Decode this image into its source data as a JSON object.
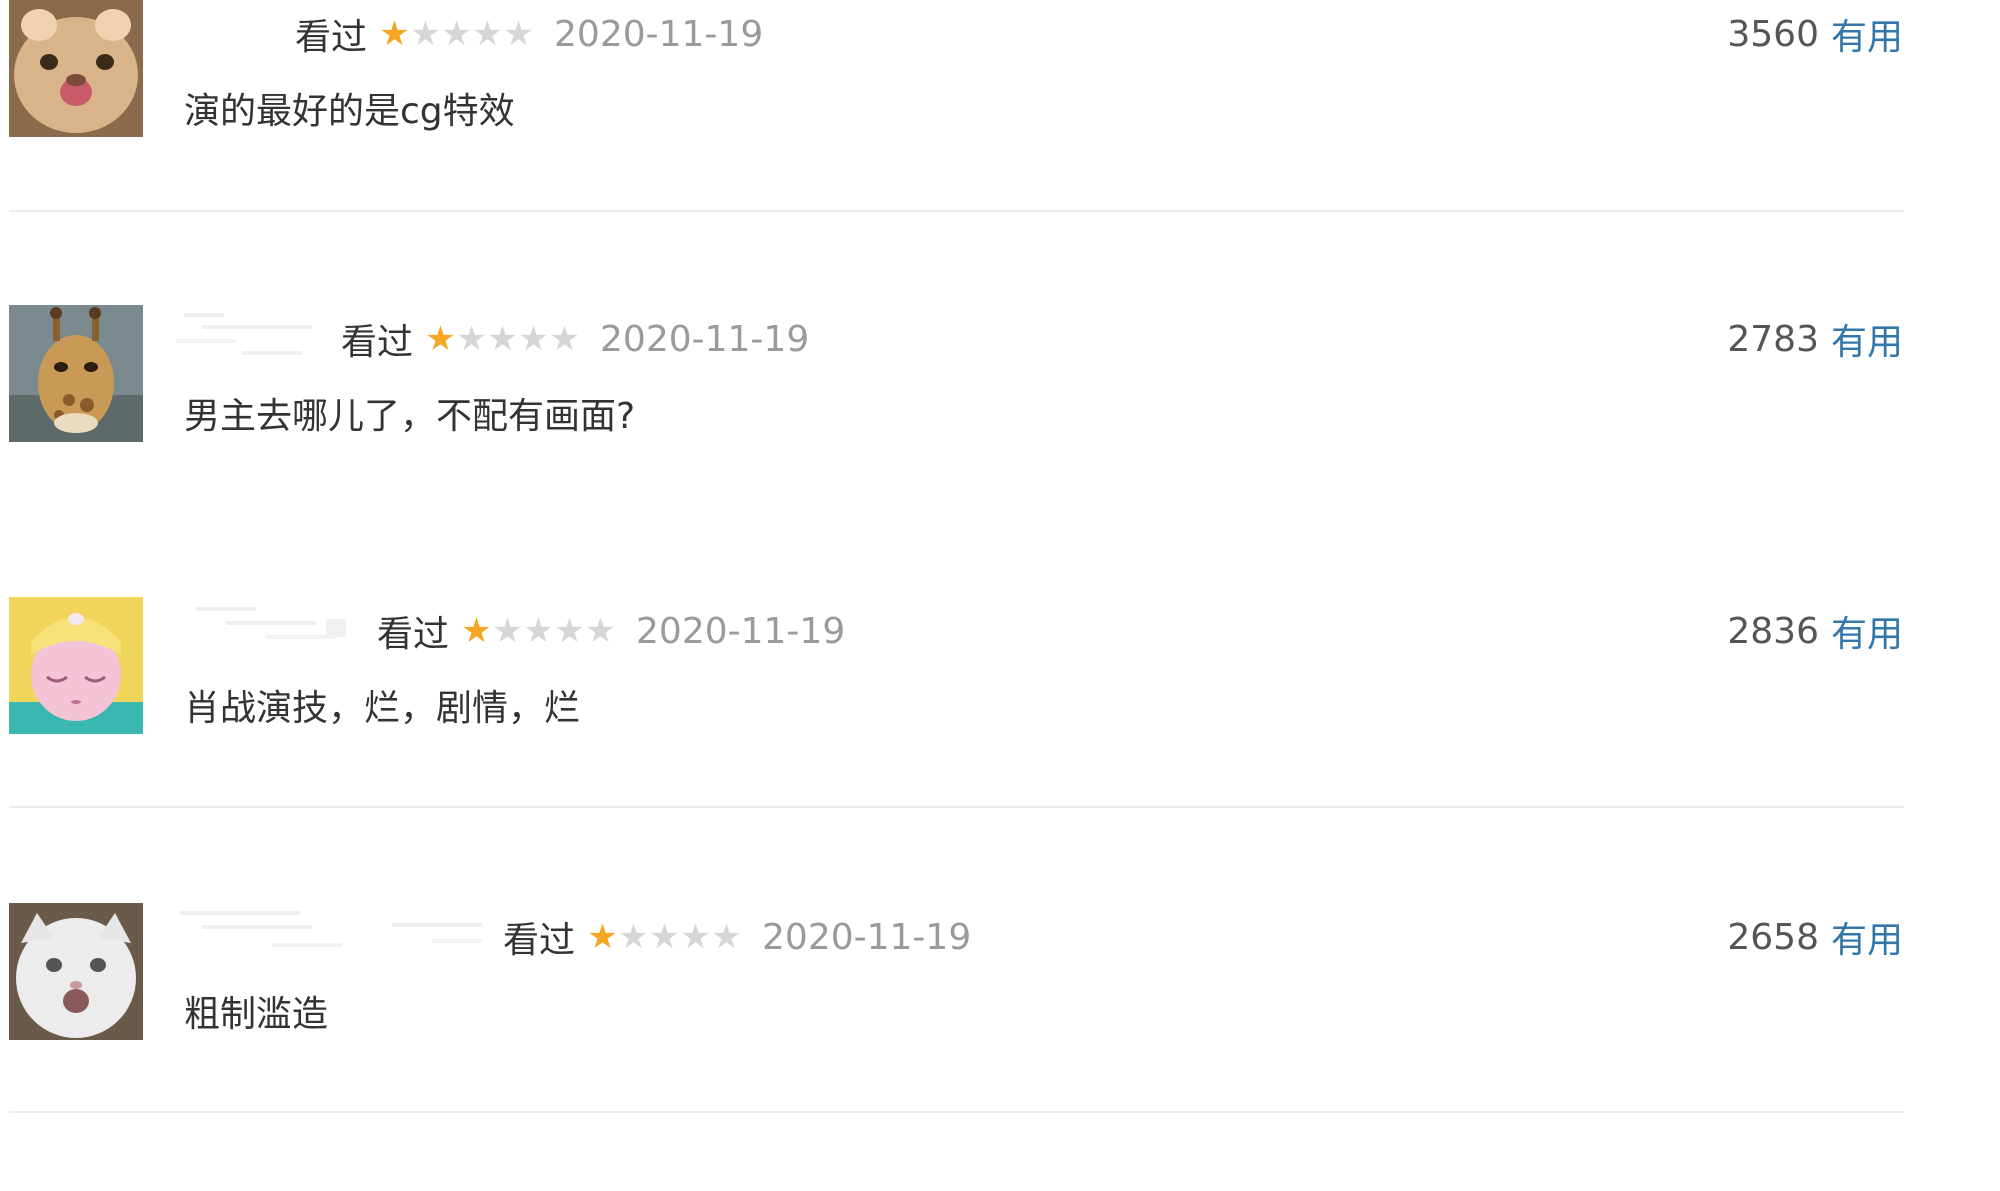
{
  "colors": {
    "star_on": "#f5a623",
    "star_off": "#d6d6d6",
    "link": "#3377aa",
    "date": "#9a9a9a",
    "divider": "#ececec"
  },
  "reviews": [
    {
      "status": "看过",
      "rating": 1,
      "max_rating": 5,
      "date": "2020-11-19",
      "votes": "3560",
      "useful_label": "有用",
      "comment": "演的最好的是cg特效",
      "avatar_icon": "cat-avatar-icon"
    },
    {
      "status": "看过",
      "rating": 1,
      "max_rating": 5,
      "date": "2020-11-19",
      "votes": "2783",
      "useful_label": "有用",
      "comment": "男主去哪儿了，不配有画面?",
      "avatar_icon": "giraffe-avatar-icon"
    },
    {
      "status": "看过",
      "rating": 1,
      "max_rating": 5,
      "date": "2020-11-19",
      "votes": "2836",
      "useful_label": "有用",
      "comment": "肖战演技，烂，剧情，烂",
      "avatar_icon": "anime-girl-avatar-icon"
    },
    {
      "status": "看过",
      "rating": 1,
      "max_rating": 5,
      "date": "2020-11-19",
      "votes": "2658",
      "useful_label": "有用",
      "comment": "粗制滥造",
      "avatar_icon": "white-cat-avatar-icon"
    }
  ]
}
